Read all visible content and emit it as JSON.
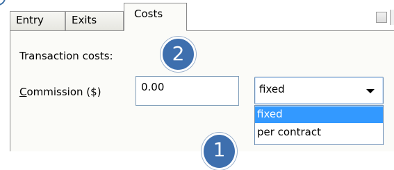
{
  "tabs": [
    {
      "label": "Entry"
    },
    {
      "label": "Exits"
    },
    {
      "label": "Costs"
    }
  ],
  "panel": {
    "transaction_costs_label": "Transaction costs:",
    "commission": {
      "label_underlined": "C",
      "label_rest": "ommission ($)",
      "value": "0.00"
    },
    "cost_type": {
      "selected": "fixed",
      "options": [
        "fixed",
        "per contract"
      ],
      "highlighted_option": "fixed"
    }
  },
  "callouts": [
    {
      "number": "2",
      "color": "#3e6fae"
    },
    {
      "number": "1",
      "color": "#3e6fae"
    }
  ],
  "colors": {
    "selection": "#3399ff",
    "callout_fill": "#3e6fae",
    "input_border": "#7f9db9"
  }
}
